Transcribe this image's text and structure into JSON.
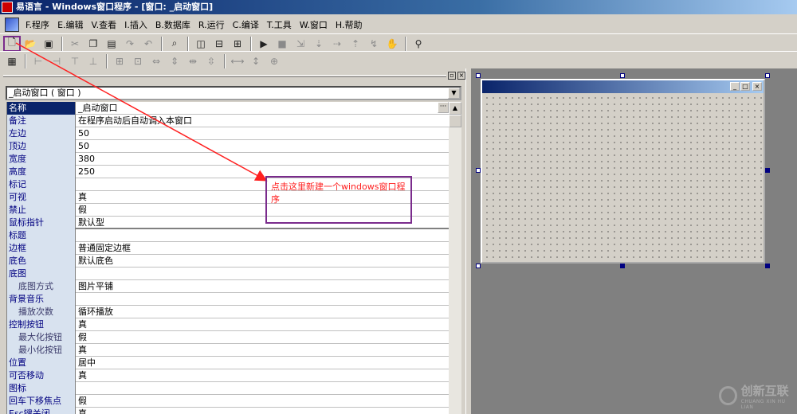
{
  "window": {
    "title": "易语言 - Windows窗口程序 - [窗口: _启动窗口]"
  },
  "menu": {
    "items": [
      {
        "label": "F.程序"
      },
      {
        "label": "E.编辑"
      },
      {
        "label": "V.查看"
      },
      {
        "label": "I.插入"
      },
      {
        "label": "B.数据库"
      },
      {
        "label": "R.运行"
      },
      {
        "label": "C.编译"
      },
      {
        "label": "T.工具"
      },
      {
        "label": "W.窗口"
      },
      {
        "label": "H.帮助"
      }
    ]
  },
  "toolbar": {
    "new_icon": "new-file-icon",
    "buttons": [
      {
        "name": "new-window-button",
        "glyph": "🗋"
      },
      {
        "name": "open-button",
        "glyph": "📂"
      },
      {
        "name": "save-button",
        "glyph": "💾"
      }
    ]
  },
  "property_panel": {
    "object_selector": "_启动窗口 ( 窗口 )",
    "rows": [
      {
        "key": "名称",
        "value": "_启动窗口",
        "selected": true
      },
      {
        "key": "备注",
        "value": "在程序启动后自动调入本窗口"
      },
      {
        "key": "左边",
        "value": "50"
      },
      {
        "key": "顶边",
        "value": "50"
      },
      {
        "key": "宽度",
        "value": "380"
      },
      {
        "key": "高度",
        "value": "250"
      },
      {
        "key": "标记",
        "value": ""
      },
      {
        "key": "可视",
        "value": "真"
      },
      {
        "key": "禁止",
        "value": "假"
      },
      {
        "key": "鼠标指针",
        "value": "默认型"
      },
      {
        "key": "标题",
        "value": ""
      },
      {
        "key": "边框",
        "value": "普通固定边框"
      },
      {
        "key": "底色",
        "value": "默认底色"
      },
      {
        "key": "底图",
        "value": ""
      },
      {
        "key": "底图方式",
        "value": "图片平铺",
        "sub": true
      },
      {
        "key": "背景音乐",
        "value": ""
      },
      {
        "key": "播放次数",
        "value": "循环播放",
        "sub": true
      },
      {
        "key": "控制按钮",
        "value": "真"
      },
      {
        "key": "最大化按钮",
        "value": "假",
        "sub": true
      },
      {
        "key": "最小化按钮",
        "value": "真",
        "sub": true
      },
      {
        "key": "位置",
        "value": "居中"
      },
      {
        "key": "可否移动",
        "value": "真"
      },
      {
        "key": "图标",
        "value": ""
      },
      {
        "key": "回车下移焦点",
        "value": "假"
      },
      {
        "key": "Esc键关闭",
        "value": "真"
      }
    ]
  },
  "annotation": {
    "text": "点击这里新建一个windows窗口程序",
    "color": "#ff2020",
    "border": "#7a2b8c"
  },
  "watermark": {
    "name": "创新互联",
    "sub": "CHUANG XIN HU LIAN"
  }
}
